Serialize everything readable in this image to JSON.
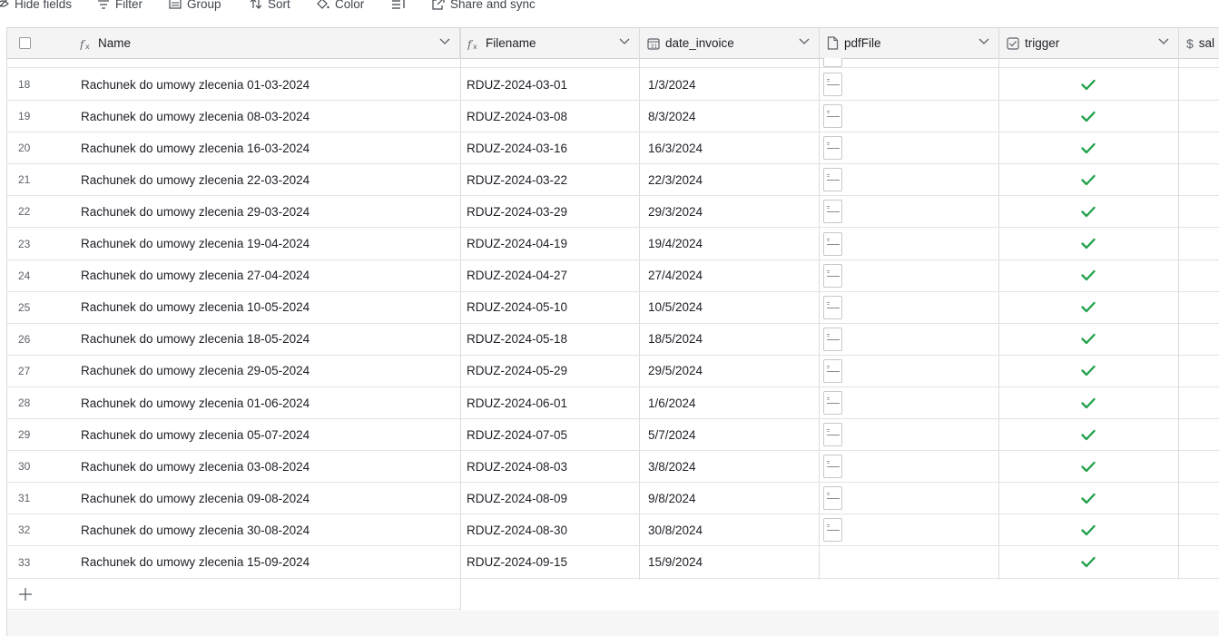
{
  "toolbar": {
    "hide_fields": "Hide fields",
    "filter": "Filter",
    "group": "Group",
    "sort": "Sort",
    "color": "Color",
    "share_sync": "Share and sync"
  },
  "columns": {
    "name": "Name",
    "filename": "Filename",
    "date_invoice": "date_invoice",
    "pdffile": "pdfFile",
    "trigger": "trigger",
    "salary_partial": "sal"
  },
  "rows": [
    {
      "num": "18",
      "name": "Rachunek do umowy zlecenia 01-03-2024",
      "filename": "RDUZ-2024-03-01",
      "date": "1/3/2024",
      "has_pdf": true,
      "trigger": true
    },
    {
      "num": "19",
      "name": "Rachunek do umowy zlecenia 08-03-2024",
      "filename": "RDUZ-2024-03-08",
      "date": "8/3/2024",
      "has_pdf": true,
      "trigger": true
    },
    {
      "num": "20",
      "name": "Rachunek do umowy zlecenia 16-03-2024",
      "filename": "RDUZ-2024-03-16",
      "date": "16/3/2024",
      "has_pdf": true,
      "trigger": true
    },
    {
      "num": "21",
      "name": "Rachunek do umowy zlecenia 22-03-2024",
      "filename": "RDUZ-2024-03-22",
      "date": "22/3/2024",
      "has_pdf": true,
      "trigger": true
    },
    {
      "num": "22",
      "name": "Rachunek do umowy zlecenia 29-03-2024",
      "filename": "RDUZ-2024-03-29",
      "date": "29/3/2024",
      "has_pdf": true,
      "trigger": true
    },
    {
      "num": "23",
      "name": "Rachunek do umowy zlecenia 19-04-2024",
      "filename": "RDUZ-2024-04-19",
      "date": "19/4/2024",
      "has_pdf": true,
      "trigger": true
    },
    {
      "num": "24",
      "name": "Rachunek do umowy zlecenia 27-04-2024",
      "filename": "RDUZ-2024-04-27",
      "date": "27/4/2024",
      "has_pdf": true,
      "trigger": true
    },
    {
      "num": "25",
      "name": "Rachunek do umowy zlecenia 10-05-2024",
      "filename": "RDUZ-2024-05-10",
      "date": "10/5/2024",
      "has_pdf": true,
      "trigger": true
    },
    {
      "num": "26",
      "name": "Rachunek do umowy zlecenia 18-05-2024",
      "filename": "RDUZ-2024-05-18",
      "date": "18/5/2024",
      "has_pdf": true,
      "trigger": true
    },
    {
      "num": "27",
      "name": "Rachunek do umowy zlecenia 29-05-2024",
      "filename": "RDUZ-2024-05-29",
      "date": "29/5/2024",
      "has_pdf": true,
      "trigger": true
    },
    {
      "num": "28",
      "name": "Rachunek do umowy zlecenia 01-06-2024",
      "filename": "RDUZ-2024-06-01",
      "date": "1/6/2024",
      "has_pdf": true,
      "trigger": true
    },
    {
      "num": "29",
      "name": "Rachunek do umowy zlecenia 05-07-2024",
      "filename": "RDUZ-2024-07-05",
      "date": "5/7/2024",
      "has_pdf": true,
      "trigger": true
    },
    {
      "num": "30",
      "name": "Rachunek do umowy zlecenia 03-08-2024",
      "filename": "RDUZ-2024-08-03",
      "date": "3/8/2024",
      "has_pdf": true,
      "trigger": true
    },
    {
      "num": "31",
      "name": "Rachunek do umowy zlecenia 09-08-2024",
      "filename": "RDUZ-2024-08-09",
      "date": "9/8/2024",
      "has_pdf": true,
      "trigger": true
    },
    {
      "num": "32",
      "name": "Rachunek do umowy zlecenia 30-08-2024",
      "filename": "RDUZ-2024-08-30",
      "date": "30/8/2024",
      "has_pdf": true,
      "trigger": true
    },
    {
      "num": "33",
      "name": "Rachunek do umowy zlecenia 15-09-2024",
      "filename": "RDUZ-2024-09-15",
      "date": "15/9/2024",
      "has_pdf": false,
      "trigger": true
    }
  ],
  "colors": {
    "check_green": "#20a04a",
    "header_bg": "#f4f4f4",
    "border": "#dcdcdc"
  },
  "icons": {
    "formula": "formula-icon",
    "calendar": "calendar-icon",
    "document": "document-icon",
    "checkbox": "checkbox-icon",
    "currency": "currency-icon",
    "check": "check-icon",
    "plus": "plus-icon"
  }
}
